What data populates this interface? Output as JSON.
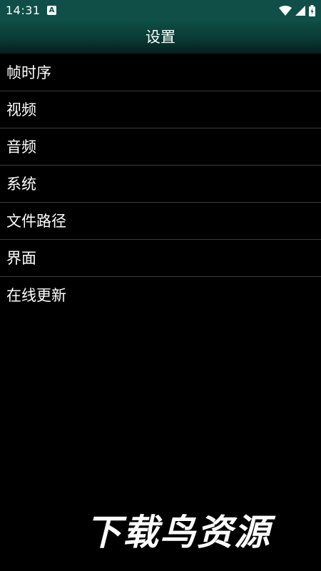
{
  "status_bar": {
    "time": "14:31",
    "notification_icon": "A",
    "icons": [
      "wifi-icon",
      "cell-signal-icon",
      "battery-charging-icon"
    ]
  },
  "app_bar": {
    "title": "设置"
  },
  "menu": {
    "items": [
      {
        "label": "帧时序"
      },
      {
        "label": "视频"
      },
      {
        "label": "音频"
      },
      {
        "label": "系统"
      },
      {
        "label": "文件路径"
      },
      {
        "label": "界面"
      },
      {
        "label": "在线更新"
      }
    ]
  },
  "watermark": {
    "text": "下载鸟资源"
  },
  "colors": {
    "background": "#000000",
    "app_bar": "#0d4d45",
    "divider": "#3c3c3c",
    "text": "#ffffff"
  }
}
